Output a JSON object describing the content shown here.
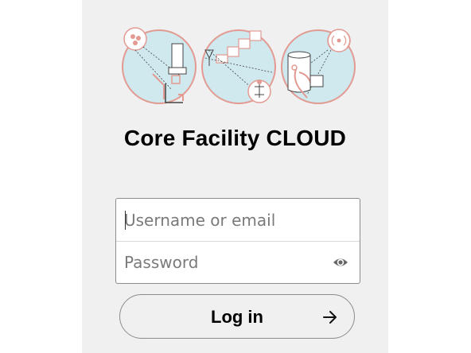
{
  "app": {
    "title": "Core Facility CLOUD"
  },
  "logo": {
    "icons": [
      "microscope-circle-icon",
      "sequencing-circle-icon",
      "rodent-cage-circle-icon"
    ],
    "colors": {
      "circle_fill": "#cfe9ee",
      "circle_stroke": "#e39a92",
      "line": "#444444"
    }
  },
  "login": {
    "username": {
      "placeholder": "Username or email",
      "value": ""
    },
    "password": {
      "placeholder": "Password",
      "value": "",
      "toggle_icon": "eye-icon"
    },
    "submit": {
      "label": "Log in",
      "icon": "arrow-right-icon"
    }
  },
  "colors": {
    "panel_background": "#f0f0f0",
    "page_background": "#ffffff",
    "border": "#8c8c8c",
    "text": "#000000",
    "placeholder": "#7a7a7a"
  }
}
